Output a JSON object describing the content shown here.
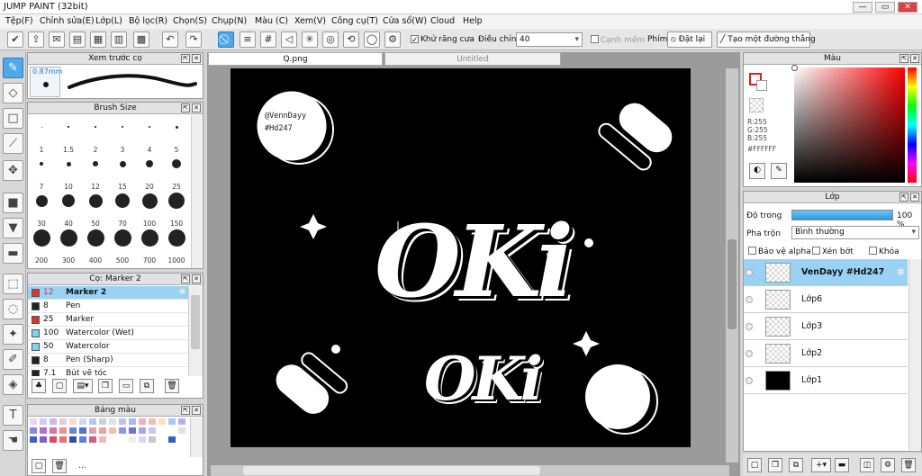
{
  "window": {
    "title": "JUMP PAINT (32bit)"
  },
  "menu": [
    "Tệp(F)",
    "Chỉnh sửa(E)",
    "Lớp(L)",
    "Bộ lọc(R)",
    "Chọn(S)",
    "Chụp(N)",
    "Màu (C)",
    "Xem(V)",
    "Công cụ(T)",
    "Cửa sổ(W)",
    "Cloud",
    "Help"
  ],
  "toolbar": {
    "antialias_label": "Khử răng cưa",
    "adjust_label": "Điều chỉnh",
    "adjust_value": "40",
    "snap_label": "Cạnh mềm",
    "key_label": "Phím",
    "reset_label": "Đặt lại",
    "straight_label": "Tạo một đường thẳng"
  },
  "brush_preview": {
    "title": "Xem trước cọ",
    "size": "0.87mm"
  },
  "brush_size": {
    "title": "Brush Size",
    "sizes": [
      "1",
      "1.5",
      "2",
      "3",
      "4",
      "5",
      "7",
      "10",
      "12",
      "15",
      "20",
      "25",
      "30",
      "40",
      "50",
      "70",
      "100",
      "150",
      "200",
      "300",
      "400",
      "500",
      "700",
      "1000"
    ]
  },
  "brush_list": {
    "title": "Cọ: Marker 2",
    "items": [
      {
        "size": "12",
        "name": "Marker 2",
        "color": "#e03030"
      },
      {
        "size": "8",
        "name": "Pen",
        "color": "#222222"
      },
      {
        "size": "25",
        "name": "Marker",
        "color": "#e03030"
      },
      {
        "size": "100",
        "name": "Watercolor (Wet)",
        "color": "#7fd4f0"
      },
      {
        "size": "50",
        "name": "Watercolor",
        "color": "#7fd4f0"
      },
      {
        "size": "8",
        "name": "Pen (Sharp)",
        "color": "#222222"
      },
      {
        "size": "7.1",
        "name": "Bút vẽ tóc",
        "color": "#222222"
      }
    ]
  },
  "palette": {
    "title": "Bảng màu",
    "more": "..."
  },
  "tabs": {
    "active": "Q.png",
    "inactive": "Untitled"
  },
  "artwork": {
    "handle": "@VennDayy",
    "tag": "#Hd247",
    "big": "OKi",
    "small": "OKi"
  },
  "color_panel": {
    "title": "Màu",
    "r": "R:255",
    "g": "G:255",
    "b": "B:255",
    "hex": "#FFFFFF"
  },
  "layers": {
    "title": "Lớp",
    "opacity_label": "Độ trong",
    "opacity_value": "100 %",
    "opacity_fraction": 1.0,
    "blend_label": "Pha trộn",
    "blend_value": "Bình thường",
    "protect_alpha": "Bảo vệ alpha",
    "clip": "Xén bớt",
    "lock": "Khóa",
    "items": [
      {
        "name": "VenDayy #Hd247"
      },
      {
        "name": "Lớp6"
      },
      {
        "name": "Lớp3"
      },
      {
        "name": "Lớp2"
      },
      {
        "name": "Lớp1"
      }
    ]
  }
}
